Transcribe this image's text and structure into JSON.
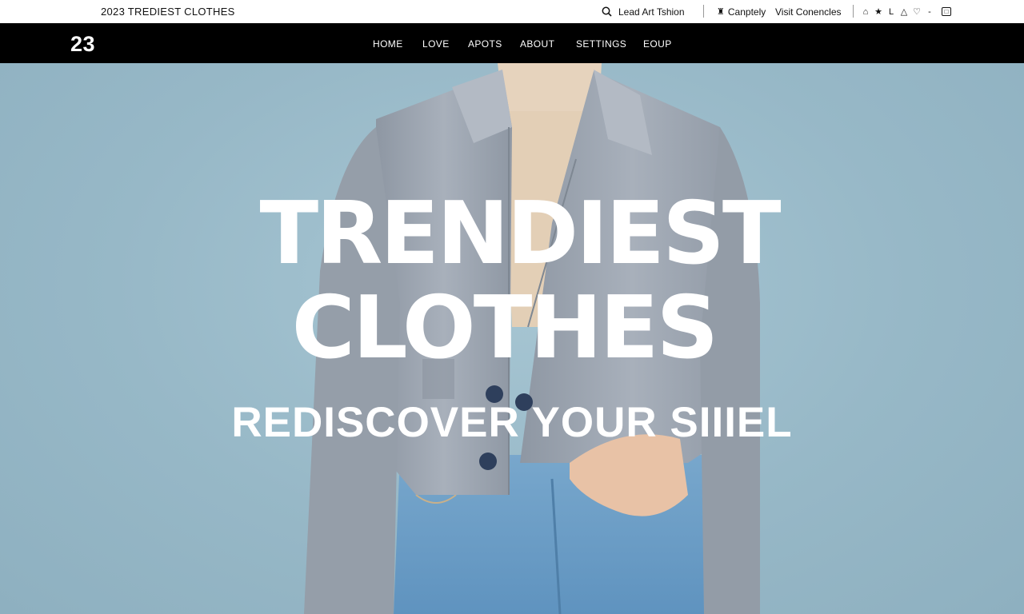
{
  "topbar": {
    "site_title": "2023 TREDIEST CLOTHES",
    "search_label": "Lead Art Tshion",
    "account_label": "Canptely",
    "visit_label": "Visit Conencles",
    "icons": [
      "home-icon",
      "star-icon",
      "user-icon",
      "location-icon",
      "heart-icon",
      "dropdown-icon",
      "cart-icon"
    ]
  },
  "nav": {
    "logo": "23",
    "items": [
      "HOME",
      "LOVE",
      "APOTS",
      "ABOUT",
      "SETTINGS",
      "EOUP"
    ]
  },
  "hero": {
    "headline_line1": "TRENDIEST",
    "headline_line2": "CLOTHES",
    "tagline": "REDISCOVER YOUR SIIIEL"
  },
  "colors": {
    "topbar_bg": "#ffffff",
    "nav_bg": "#000000",
    "hero_bg": "#9bbccb",
    "jacket": "#9ea7b3",
    "turtleneck": "#e6d3bd",
    "denim": "#6f9fc7",
    "headline": "#ffffff"
  }
}
